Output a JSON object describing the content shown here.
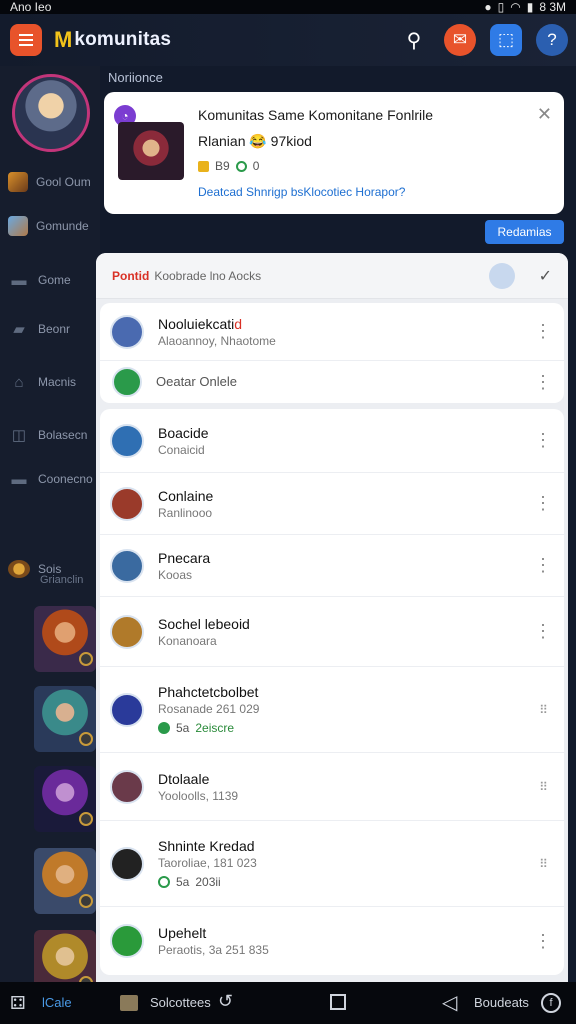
{
  "statusbar": {
    "left": "Ano Ieo",
    "right": "8 3M"
  },
  "appbar": {
    "logo_text": "komunitas"
  },
  "sidebar": {
    "items": [
      {
        "label": "Gool Oum"
      },
      {
        "label": "Gomunde"
      },
      {
        "label": "Gome"
      },
      {
        "label": "Beonr"
      },
      {
        "label": "Macnis"
      },
      {
        "label": "Bolasecn"
      },
      {
        "label": "Coonecno"
      },
      {
        "label": "Sois"
      }
    ],
    "sub_label": "Grianclin"
  },
  "notification": {
    "section_label": "Noriionce",
    "title": "Komunitas Same Komonitane Fonlrile",
    "subtitle": "Rlanian 😂 97kiod",
    "meta_count": "B9",
    "meta_extra": "0",
    "link": "Deatcad Shnrigp bsKlocotiec Horapor?",
    "cta": "Redamias"
  },
  "panel": {
    "header_accent": "Pontid",
    "header_text": "Koobrade lno Aocks"
  },
  "section1": [
    {
      "title_main": "Nooluiekcati",
      "title_hl": "d",
      "sub": "Alaoannoy, Nhaotome"
    },
    {
      "title_main": "",
      "title_hl": "",
      "sub": "Oeatar Onlele"
    }
  ],
  "section2": [
    {
      "title": "Boacide",
      "sub": "Conaicid"
    },
    {
      "title": "Conlaine",
      "sub": "Ranlinooo"
    },
    {
      "title": "Pnecara",
      "sub": "Kooas"
    },
    {
      "title": "Sochel lebeoid",
      "sub": "Konanoara"
    },
    {
      "title": "Phahctetcbolbet",
      "sub": "Rosanade 261 029",
      "stat_icon": "5a",
      "stat_text": "2eiscre"
    },
    {
      "title": "Dtolaale",
      "sub": "Yooloolls, 1139"
    },
    {
      "title": "Shninte Kredad",
      "sub": "Taoroliae, 181 023",
      "stat_icon": "5a",
      "stat_text": "203ii"
    },
    {
      "title": "Upehelt",
      "sub": "Peraotis, 3a 251 835"
    }
  ],
  "navbar": {
    "home_label": "lCale",
    "library_label": "Solcottees",
    "account_label": "Boudeats"
  }
}
